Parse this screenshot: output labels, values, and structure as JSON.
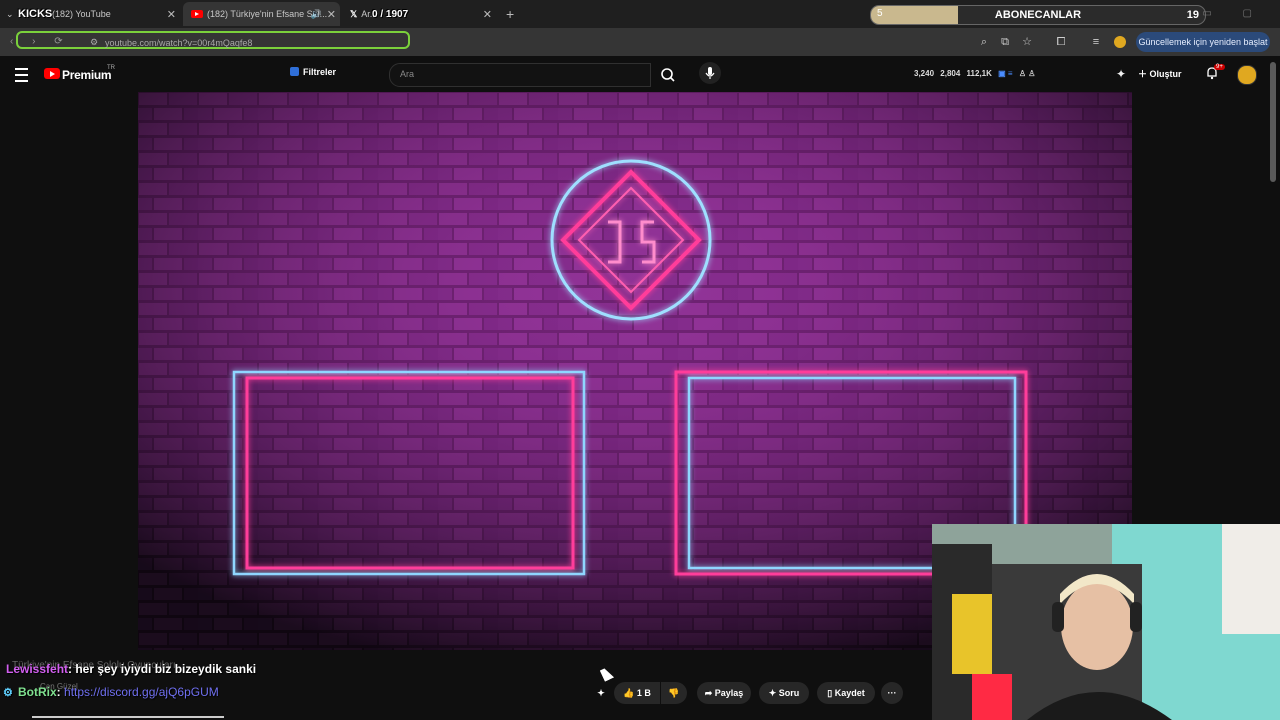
{
  "browser": {
    "tabs": [
      {
        "title": "(182) YouTube"
      },
      {
        "title": "(182) Türkiye'nin Efsane Sol..."
      },
      {
        "title": "Ar..."
      }
    ],
    "kicks_label": "KICKS",
    "kick_counter": "0 / 1907",
    "url": "youtube.com/watch?v=00r4mQaqfe8",
    "update_button": "Güncellemek için yeniden başlat"
  },
  "sub_goal": {
    "left_value": "5",
    "label": "ABONECANLAR",
    "right_value": "19",
    "progress": 0.26
  },
  "youtube": {
    "brand": "Premium",
    "region": "TR",
    "filter_label": "Filtreler",
    "search_placeholder": "Ara",
    "stats": [
      "3,240",
      "2,804",
      "112,1K"
    ],
    "create_label": "Oluştur",
    "notif_badge": "9+"
  },
  "chat": {
    "line1_user": "Lewissfeht",
    "line1_text": ": her şey iyiydi biz bizeydik sanki",
    "line1_under": "Türkiye'nin Efsane Sololu Oyuncuları",
    "line2_user": "BotRix",
    "line2_sep": ": ",
    "line2_link": "https://discord.gg/ajQ6pGUM",
    "under_name": "Can Güzel"
  },
  "actions": {
    "like_count": "1 B",
    "share": "Paylaş",
    "ask": "Soru",
    "save": "Kaydet"
  },
  "colors": {
    "neon_pink": "#ff3c9a",
    "neon_blue": "#7fd0ff",
    "brick": "#5a2a5e"
  }
}
